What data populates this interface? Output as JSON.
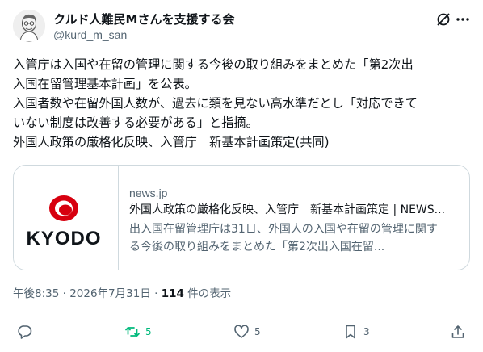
{
  "author": {
    "name": "クルド人難民Mさんを支援する会",
    "handle": "@kurd_m_san"
  },
  "post": {
    "lines": [
      "入管庁は入国や在留の管理に関する今後の取り組みをまとめた「第2次出",
      "入国在留管理基本計画」を公表。",
      "入国者数や在留外国人数が、過去に類を見ない高水準だとし「対応できて",
      "いない制度は改善する必要がある」と指摘。",
      "外国人政策の厳格化反映、入管庁　新基本計画策定(共同)"
    ]
  },
  "card": {
    "logo_text": "KYODO",
    "domain": "news.jp",
    "title": "外国人政策の厳格化反映、入管庁　新基本計画策定 | NEWS...",
    "desc_lines": [
      "出入国在留管理庁は31日、外国人の入国や在留の管理に関す",
      "る今後の取り組みをまとめた「第2次出入国在留..."
    ]
  },
  "meta": {
    "timestamp": "午後8:35 · 2026年7月31日 · ",
    "views_count": "114",
    "views_label": " 件の表示"
  },
  "actions": {
    "reply_count": "",
    "retweet_count": "5",
    "like_count": "5",
    "bookmark_count": "3"
  },
  "colors": {
    "retweet_green": "#00ba7c",
    "secondary_text": "#536471",
    "kyodo_red": "#d7000f"
  }
}
